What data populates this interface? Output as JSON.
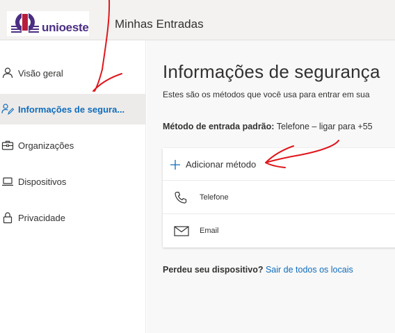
{
  "header": {
    "logo_text": "unioeste",
    "app_title": "Minhas Entradas"
  },
  "sidebar": {
    "items": [
      {
        "label": "Visão geral",
        "icon": "person-icon",
        "active": false
      },
      {
        "label": "Informações de segura...",
        "icon": "security-info-icon",
        "active": true
      },
      {
        "label": "Organizações",
        "icon": "briefcase-icon",
        "active": false
      },
      {
        "label": "Dispositivos",
        "icon": "laptop-icon",
        "active": false
      },
      {
        "label": "Privacidade",
        "icon": "lock-icon",
        "active": false
      }
    ]
  },
  "main": {
    "title": "Informações de segurança",
    "subtitle": "Estes são os métodos que você usa para entrar em sua",
    "default_method_label": "Método de entrada padrão:",
    "default_method_value": "Telefone – ligar para +55",
    "add_method_label": "Adicionar método",
    "methods": [
      {
        "label": "Telefone",
        "icon": "phone-icon"
      },
      {
        "label": "Email",
        "icon": "email-icon"
      }
    ],
    "lost_device_label": "Perdeu seu dispositivo?",
    "lost_device_link": "Sair de todos os locais"
  },
  "colors": {
    "accent": "#0f6cbd",
    "topbar_bg": "#f3f2f1",
    "main_bg": "#f8f8f8",
    "active_nav_bg": "#edebe9",
    "annotation": "#e0161b",
    "logo_purple": "#4b2e83"
  }
}
